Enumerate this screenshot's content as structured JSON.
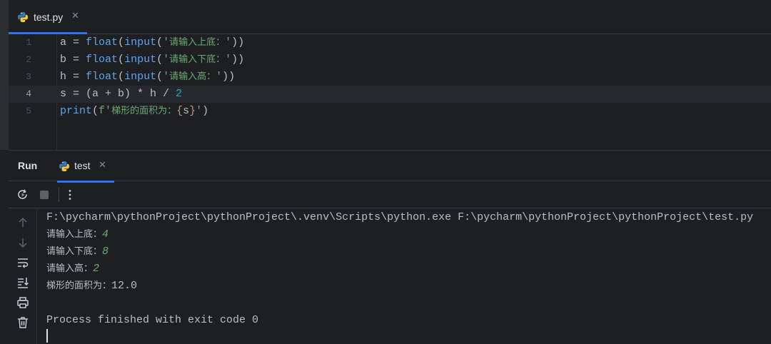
{
  "editor": {
    "tab_label": "test.py",
    "lines": [
      {
        "num": "1",
        "var": "a",
        "fn1": "float",
        "fn2": "input",
        "prompt": "请输入上底："
      },
      {
        "num": "2",
        "var": "b",
        "fn1": "float",
        "fn2": "input",
        "prompt": "请输入下底："
      },
      {
        "num": "3",
        "var": "h",
        "fn1": "float",
        "fn2": "input",
        "prompt": "请输入高："
      },
      {
        "num": "4",
        "code_pre": "s = (a + b) * h / ",
        "code_num": "2"
      },
      {
        "num": "5",
        "fn": "print",
        "fprefix": "f",
        "label": "梯形的面积为：",
        "expr": "s"
      }
    ]
  },
  "run_panel": {
    "title": "Run",
    "tab_label": "test"
  },
  "console": {
    "command": "F:\\pycharm\\pythonProject\\pythonProject\\.venv\\Scripts\\python.exe F:\\pycharm\\pythonProject\\pythonProject\\test.py",
    "inputs": [
      {
        "prompt": "请输入上底：",
        "value": "4"
      },
      {
        "prompt": "请输入下底：",
        "value": "8"
      },
      {
        "prompt": "请输入高：",
        "value": "2"
      }
    ],
    "result_prompt": "梯形的面积为：",
    "result_value": "12.0",
    "exit_message": "Process finished with exit code 0"
  },
  "colors": {
    "background": "#1e1f22",
    "accent": "#3574f0",
    "function": "#56a8f5",
    "string": "#6aab73",
    "number": "#2aacb8"
  },
  "icons": [
    "python-icon",
    "close-icon",
    "rerun-icon",
    "stop-icon",
    "more-options-icon",
    "arrow-up-icon",
    "arrow-down-icon",
    "soft-wrap-icon",
    "scroll-to-end-icon",
    "print-icon",
    "trash-icon"
  ]
}
